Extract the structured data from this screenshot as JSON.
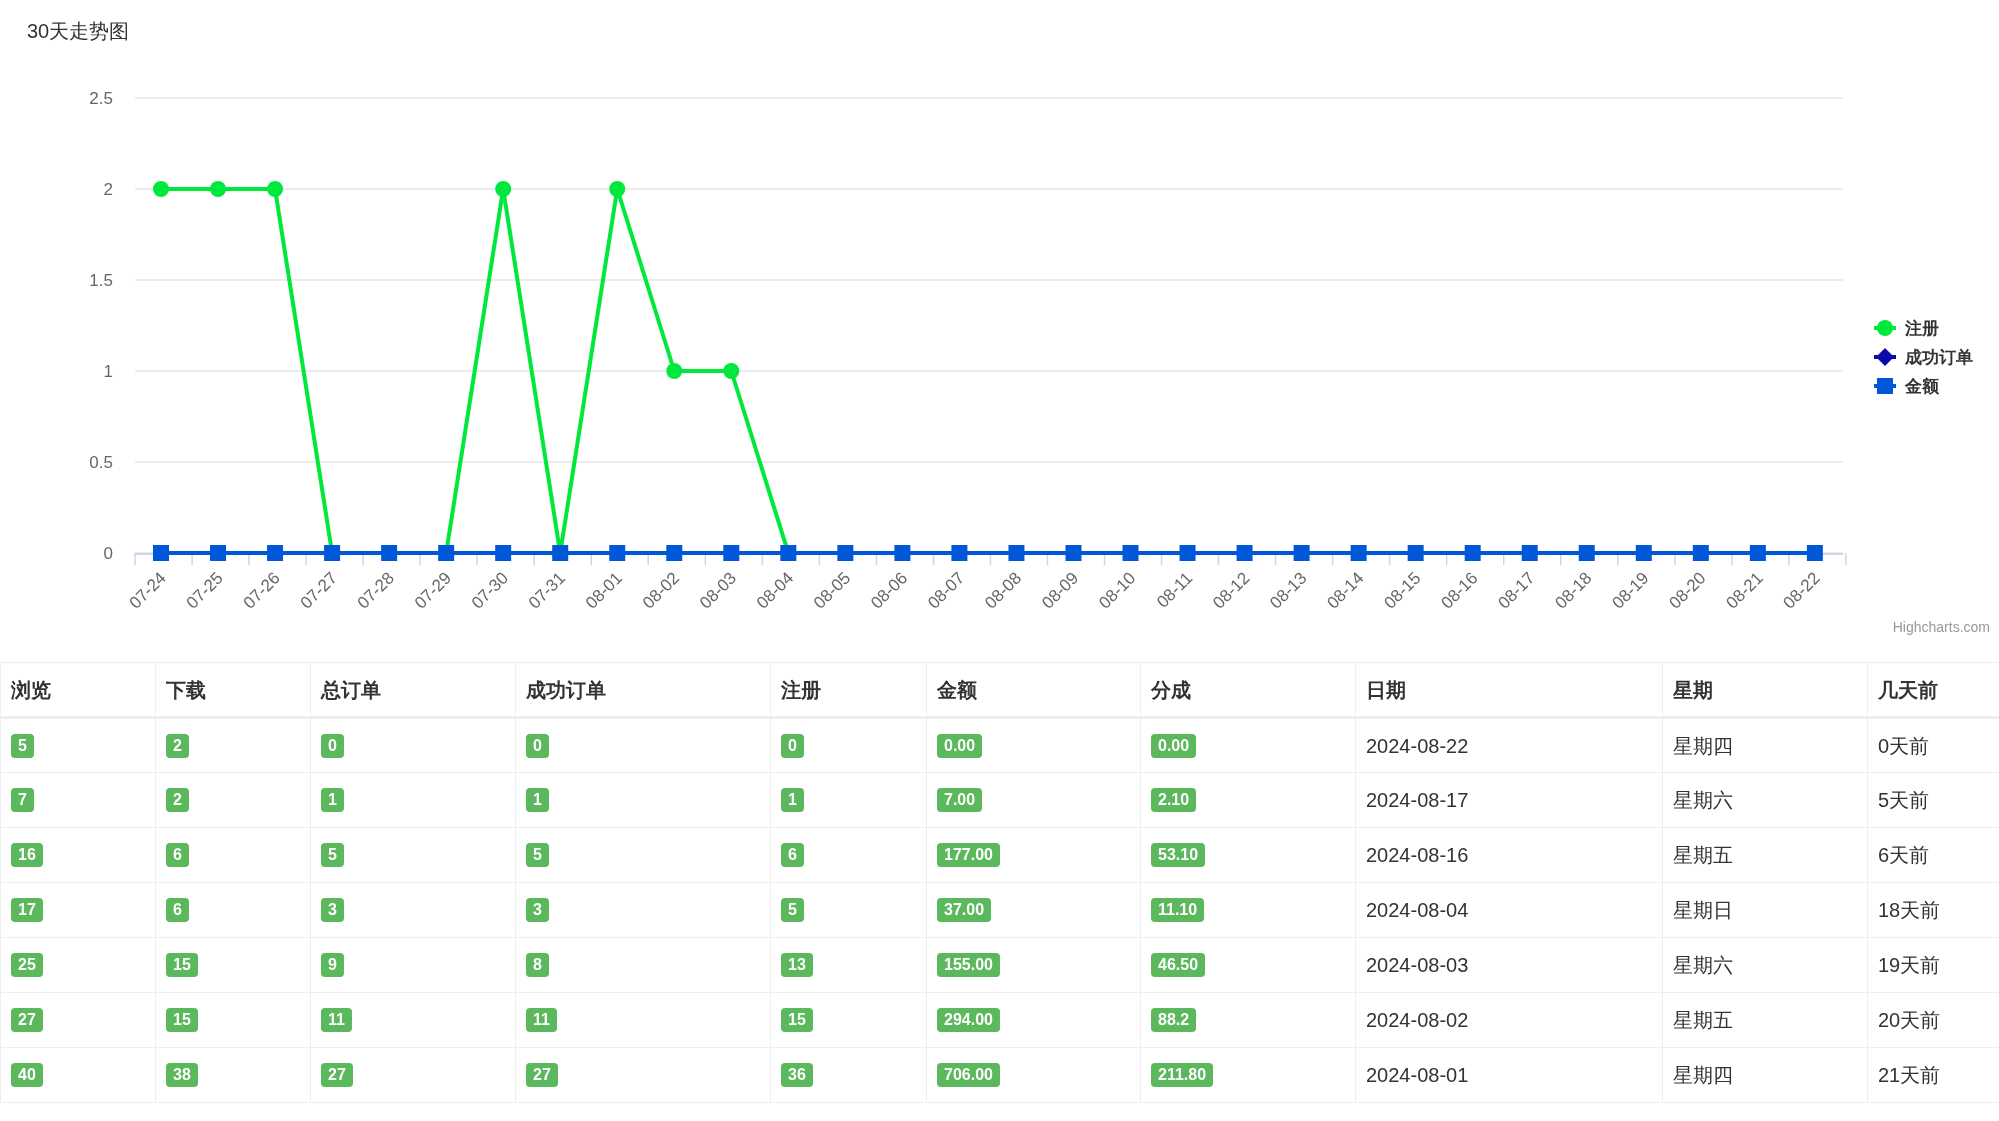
{
  "chart": {
    "title": "30天走势图",
    "credit": "Highcharts.com",
    "chart_data": {
      "type": "line",
      "categories": [
        "07-24",
        "07-25",
        "07-26",
        "07-27",
        "07-28",
        "07-29",
        "07-30",
        "07-31",
        "08-01",
        "08-02",
        "08-03",
        "08-04",
        "08-05",
        "08-06",
        "08-07",
        "08-08",
        "08-09",
        "08-10",
        "08-11",
        "08-12",
        "08-13",
        "08-14",
        "08-15",
        "08-16",
        "08-17",
        "08-18",
        "08-19",
        "08-20",
        "08-21",
        "08-22"
      ],
      "ylim": [
        0,
        2.5
      ],
      "yticks": [
        0,
        0.5,
        1,
        1.5,
        2,
        2.5
      ],
      "grid": true,
      "legend": true,
      "series": [
        {
          "name": "注册",
          "color": "#00e83b",
          "marker": "circle",
          "values": [
            2,
            2,
            2,
            0,
            null,
            0,
            2,
            0,
            2,
            1,
            1,
            0,
            null,
            null,
            null,
            null,
            null,
            null,
            null,
            null,
            null,
            null,
            null,
            null,
            null,
            null,
            null,
            null,
            null,
            null
          ]
        },
        {
          "name": "成功订单",
          "color": "#0a0aa8",
          "marker": "diamond",
          "values": [
            null,
            null,
            null,
            null,
            null,
            null,
            null,
            null,
            null,
            null,
            null,
            null,
            null,
            null,
            null,
            null,
            null,
            null,
            null,
            null,
            null,
            null,
            null,
            null,
            null,
            null,
            null,
            null,
            null,
            null
          ]
        },
        {
          "name": "金额",
          "color": "#0058d8",
          "marker": "square",
          "values": [
            0,
            0,
            0,
            0,
            0,
            0,
            0,
            0,
            0,
            0,
            0,
            0,
            0,
            0,
            0,
            0,
            0,
            0,
            0,
            0,
            0,
            0,
            0,
            0,
            0,
            0,
            0,
            0,
            0,
            0
          ]
        }
      ]
    }
  },
  "table": {
    "columns": [
      {
        "label": "浏览",
        "kind": "badge"
      },
      {
        "label": "下载",
        "kind": "badge"
      },
      {
        "label": "总订单",
        "kind": "badge"
      },
      {
        "label": "成功订单",
        "kind": "badge"
      },
      {
        "label": "注册",
        "kind": "badge"
      },
      {
        "label": "金额",
        "kind": "badge"
      },
      {
        "label": "分成",
        "kind": "badge"
      },
      {
        "label": "日期",
        "kind": "text"
      },
      {
        "label": "星期",
        "kind": "text"
      },
      {
        "label": "几天前",
        "kind": "text"
      }
    ],
    "rows": [
      [
        "5",
        "2",
        "0",
        "0",
        "0",
        "0.00",
        "0.00",
        "2024-08-22",
        "星期四",
        "0天前"
      ],
      [
        "7",
        "2",
        "1",
        "1",
        "1",
        "7.00",
        "2.10",
        "2024-08-17",
        "星期六",
        "5天前"
      ],
      [
        "16",
        "6",
        "5",
        "5",
        "6",
        "177.00",
        "53.10",
        "2024-08-16",
        "星期五",
        "6天前"
      ],
      [
        "17",
        "6",
        "3",
        "3",
        "5",
        "37.00",
        "11.10",
        "2024-08-04",
        "星期日",
        "18天前"
      ],
      [
        "25",
        "15",
        "9",
        "8",
        "13",
        "155.00",
        "46.50",
        "2024-08-03",
        "星期六",
        "19天前"
      ],
      [
        "27",
        "15",
        "11",
        "11",
        "15",
        "294.00",
        "88.2",
        "2024-08-02",
        "星期五",
        "20天前"
      ],
      [
        "40",
        "38",
        "27",
        "27",
        "36",
        "706.00",
        "211.80",
        "2024-08-01",
        "星期四",
        "21天前"
      ]
    ]
  }
}
